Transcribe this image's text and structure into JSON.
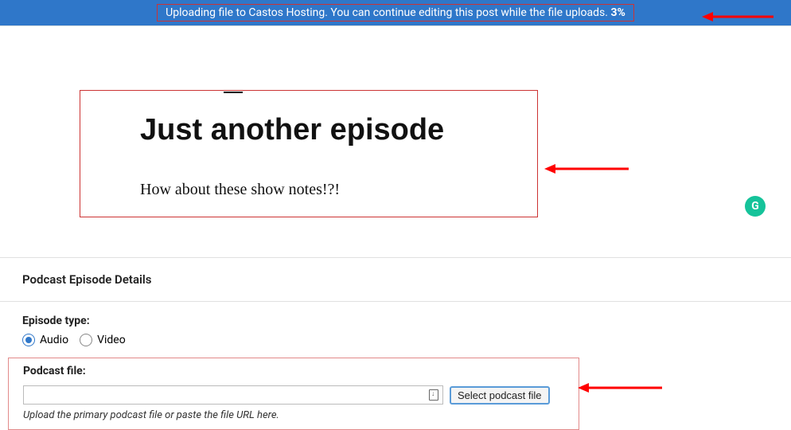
{
  "banner": {
    "message": "Uploading file to Castos Hosting. You can continue editing this post while the file uploads.",
    "percent": "3%"
  },
  "post": {
    "title": "Just another episode",
    "body": "How about these show notes!?!"
  },
  "grammarly": {
    "glyph": "G"
  },
  "meta": {
    "section_title": "Podcast Episode Details",
    "episode_type": {
      "label": "Episode type:",
      "options": {
        "audio": "Audio",
        "video": "Video"
      },
      "selected": "audio"
    },
    "podcast_file": {
      "label": "Podcast file:",
      "value": "",
      "button": "Select podcast file",
      "hint": "Upload the primary podcast file or paste the file URL here."
    }
  },
  "colors": {
    "banner_bg": "#2f77c9",
    "annotation_red": "#cc3333",
    "grammarly": "#15c39a"
  }
}
